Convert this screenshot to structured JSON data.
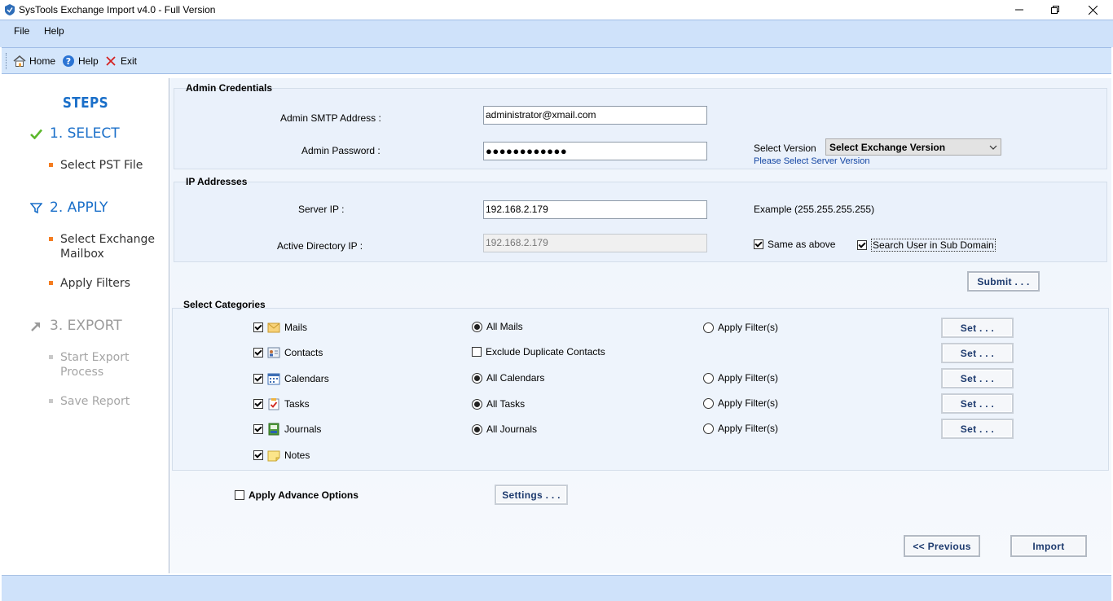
{
  "window": {
    "title": "SysTools Exchange Import v4.0 - Full Version"
  },
  "menu": {
    "items": [
      "File",
      "Help"
    ]
  },
  "toolbar": {
    "home": "Home",
    "help": "Help",
    "exit": "Exit"
  },
  "steps": {
    "title": "STEPS",
    "step1": {
      "label": "1. SELECT",
      "subs": [
        "Select PST File"
      ]
    },
    "step2": {
      "label": "2. APPLY",
      "subs": [
        "Select Exchange Mailbox",
        "Apply Filters"
      ]
    },
    "step3": {
      "label": "3. EXPORT",
      "subs": [
        "Start Export Process",
        "Save Report"
      ]
    }
  },
  "admin": {
    "group_label": "Admin Credentials",
    "smtp_label": "Admin SMTP Address :",
    "smtp_value": "administrator@xmail.com",
    "password_label": "Admin Password :",
    "password_value": "●●●●●●●●●●●●",
    "version_label": "Select Version",
    "version_value": "Select Exchange Version",
    "version_hint": "Please Select Server Version"
  },
  "ip": {
    "group_label": "IP Addresses",
    "server_label": "Server IP :",
    "server_value": "192.168.2.179",
    "example": "Example (255.255.255.255)",
    "ad_label": "Active Directory IP :",
    "ad_value": "192.168.2.179",
    "same_as_above": "Same as above",
    "search_sub_domain": "Search User in Sub Domain"
  },
  "submit_label": "Submit . . .",
  "categories": {
    "group_label": "Select Categories",
    "set_label": "Set . . .",
    "items": [
      {
        "name": "Mails",
        "option": "All Mails",
        "filter": "Apply Filter(s)"
      },
      {
        "name": "Contacts",
        "option": "Exclude Duplicate Contacts"
      },
      {
        "name": "Calendars",
        "option": "All Calendars",
        "filter": "Apply Filter(s)"
      },
      {
        "name": "Tasks",
        "option": "All Tasks",
        "filter": "Apply Filter(s)"
      },
      {
        "name": "Journals",
        "option": "All Journals",
        "filter": "Apply Filter(s)"
      },
      {
        "name": "Notes"
      }
    ]
  },
  "advance": {
    "label": "Apply Advance Options",
    "settings": "Settings . . ."
  },
  "nav": {
    "previous": "<< Previous",
    "import": "Import"
  },
  "colors": {
    "accent": "#1a6fc9",
    "bullet_active": "#f47c20",
    "bar": "#cfe2fa"
  }
}
